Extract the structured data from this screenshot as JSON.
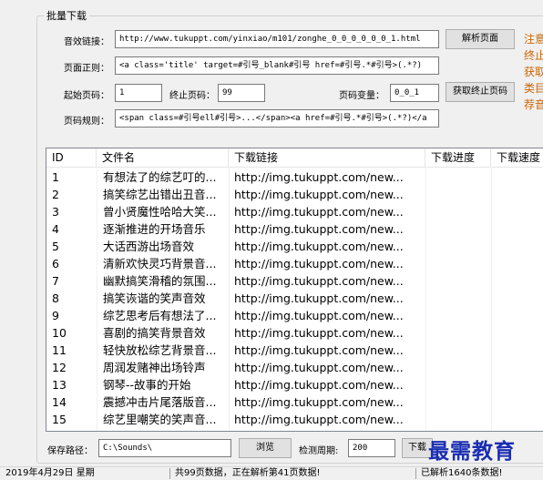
{
  "group_title": "批量下载",
  "form": {
    "url_label": "音效链接：",
    "url_value": "http://www.tukuppt.com/yinxiao/m101/zonghe_0_0_0_0_0_0_1.html",
    "parse_button": "解析页面",
    "regex_label": "页面正则：",
    "regex_value": "<a  class='title' target=#引号_blank#引号 href=#引号.*#引号>(.*?)",
    "start_label": "起始页码：",
    "start_value": "1",
    "end_label": "终止页码：",
    "end_value": "99",
    "var_label": "页码变量：",
    "var_value": "0_0_1",
    "get_end_button": "获取终止页码",
    "rule_label": "页码规则：",
    "rule_value": "<span class=#引号ell#引号>...</span><a href=#引号.*#引号>(.*?)</a"
  },
  "hints": [
    "注意",
    "终止",
    "获取",
    "类目",
    "荐音"
  ],
  "table": {
    "columns": [
      "ID",
      "文件名",
      "下载链接",
      "下载进度",
      "下载速度"
    ],
    "rows": [
      {
        "id": "1",
        "name": "有想法了的综艺叮的...",
        "url": "http://img.tukuppt.com/new..."
      },
      {
        "id": "2",
        "name": "搞笑综艺出错出丑音...",
        "url": "http://img.tukuppt.com/new..."
      },
      {
        "id": "3",
        "name": "曾小贤魔性哈哈大笑...",
        "url": "http://img.tukuppt.com/new..."
      },
      {
        "id": "4",
        "name": "逐渐推进的开场音乐",
        "url": "http://img.tukuppt.com/new..."
      },
      {
        "id": "5",
        "name": "大话西游出场音效",
        "url": "http://img.tukuppt.com/new..."
      },
      {
        "id": "6",
        "name": "清新欢快灵巧背景音...",
        "url": "http://img.tukuppt.com/new..."
      },
      {
        "id": "7",
        "name": "幽默搞笑滑稽的氛围...",
        "url": "http://img.tukuppt.com/new..."
      },
      {
        "id": "8",
        "name": "搞笑诙谐的笑声音效",
        "url": "http://img.tukuppt.com/new..."
      },
      {
        "id": "9",
        "name": "综艺思考后有想法了...",
        "url": "http://img.tukuppt.com/new..."
      },
      {
        "id": "10",
        "name": "喜剧的搞笑背景音效",
        "url": "http://img.tukuppt.com/new..."
      },
      {
        "id": "11",
        "name": "轻快放松综艺背景音...",
        "url": "http://img.tukuppt.com/new..."
      },
      {
        "id": "12",
        "name": "周润发赌神出场铃声",
        "url": "http://img.tukuppt.com/new..."
      },
      {
        "id": "13",
        "name": "钢琴--故事的开始",
        "url": "http://img.tukuppt.com/new..."
      },
      {
        "id": "14",
        "name": "震撼冲击片尾落版音...",
        "url": "http://img.tukuppt.com/new..."
      },
      {
        "id": "15",
        "name": "综艺里嘲笑的笑声音...",
        "url": "http://img.tukuppt.com/new..."
      }
    ]
  },
  "bottom": {
    "save_label": "保存路径：",
    "save_value": "C:\\Sounds\\",
    "browse_button": "浏览",
    "interval_label": "检测周期:",
    "interval_value": "200",
    "download_button": "下载"
  },
  "watermark": "最需教育",
  "status": {
    "date": "2019年4月29日  星期",
    "pages": "共99页数据，正在解析第41页数据!",
    "parsed": "已解析1640条数据!"
  }
}
